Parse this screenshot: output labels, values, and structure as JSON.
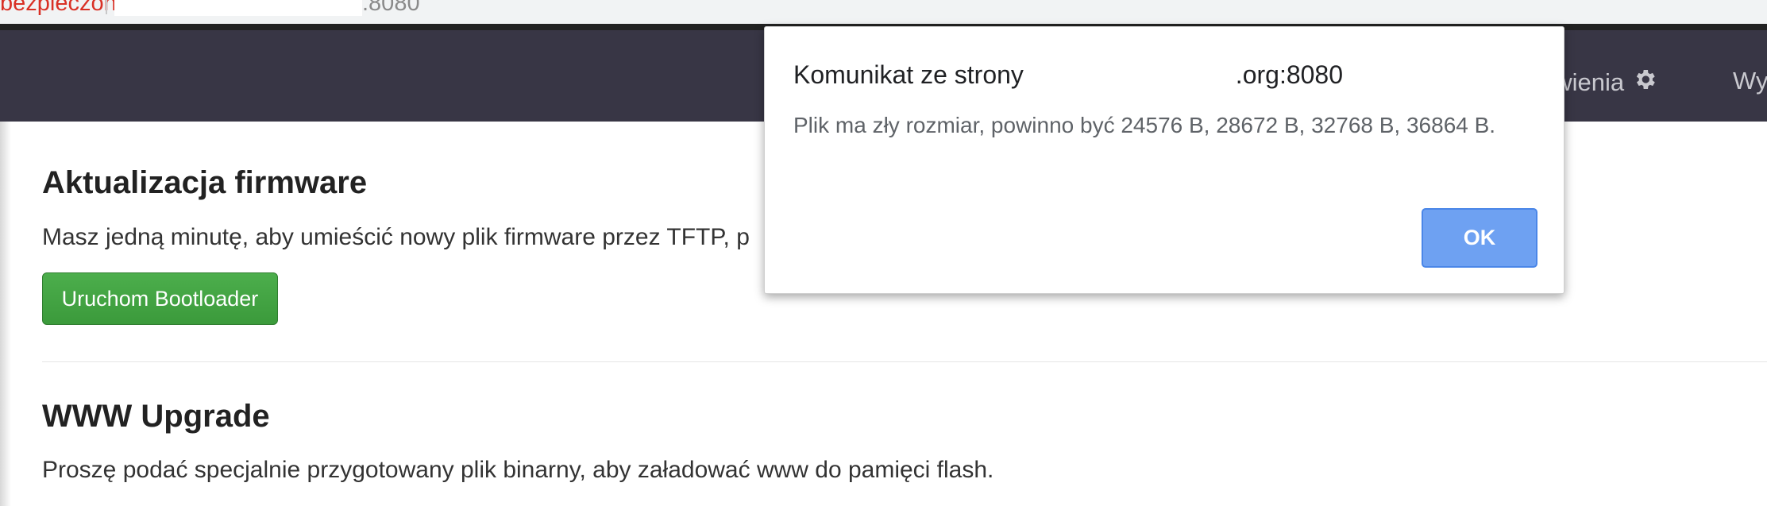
{
  "browser": {
    "security_label": "bezpieczona",
    "url_suffix": ".8080"
  },
  "navbar": {
    "settings_label": "awienia",
    "logout_label": "Wy"
  },
  "sections": {
    "firmware": {
      "title": "Aktualizacja firmware",
      "text": "Masz jedną minutę, aby umieścić nowy plik firmware przez TFTP, p",
      "button_label": "Uruchom Bootloader"
    },
    "www": {
      "title": "WWW Upgrade",
      "text": "Proszę podać specjalnie przygotowany plik binarny, aby załadować www do pamięci flash."
    }
  },
  "dialog": {
    "title_prefix": "Komunikat ze strony",
    "title_suffix": ".org:8080",
    "message": "Plik ma zły rozmiar, powinno być 24576 B, 28672 B, 32768 B, 36864 B.",
    "ok_label": "OK"
  },
  "colors": {
    "navbar": "#383645",
    "primary_button": "#6ea1f2",
    "success_button": "#449d44",
    "security_warning": "#d93025"
  },
  "icons": {
    "settings": "gear-icon"
  }
}
